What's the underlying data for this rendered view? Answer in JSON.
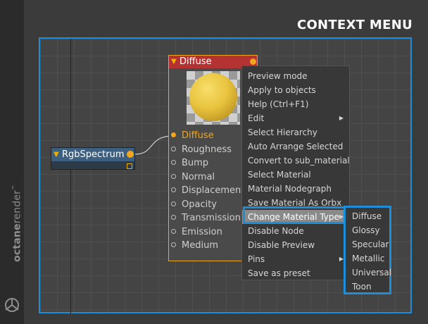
{
  "page": {
    "title": "CONTEXT MENU",
    "brand": {
      "text_bold": "octane",
      "text_regular": "render",
      "trademark": "™"
    }
  },
  "colors": {
    "accent_blue": "#1e8ed8",
    "pin_orange": "#f2a619",
    "node_header_red": "#b53232",
    "node_header_blue": "#3d5f80"
  },
  "nodes": {
    "rgb_spectrum": {
      "title": "RgbSpectrum",
      "icons": [
        "collapse-triangle-icon",
        "output-pin-icon",
        "resize-handle-icon"
      ]
    },
    "diffuse": {
      "title": "Diffuse",
      "preview": "yellow-sphere-preview",
      "pins": [
        {
          "label": "Diffuse",
          "connected": true
        },
        {
          "label": "Roughness",
          "connected": false
        },
        {
          "label": "Bump",
          "connected": false
        },
        {
          "label": "Normal",
          "connected": false
        },
        {
          "label": "Displacement",
          "connected": false
        },
        {
          "label": "Opacity",
          "connected": false
        },
        {
          "label": "Transmission",
          "connected": false
        },
        {
          "label": "Emission",
          "connected": false
        },
        {
          "label": "Medium",
          "connected": false
        }
      ]
    }
  },
  "context_menu": {
    "items": [
      {
        "label": "Preview mode",
        "submenu": false
      },
      {
        "label": "Apply to objects",
        "submenu": false
      },
      {
        "label": "Help (Ctrl+F1)",
        "submenu": false
      },
      {
        "label": "Edit",
        "submenu": true
      },
      {
        "label": "Select Hierarchy",
        "submenu": false
      },
      {
        "label": "Auto Arrange Selected",
        "submenu": false
      },
      {
        "label": "Convert to sub_material",
        "submenu": false
      },
      {
        "label": "Select Material",
        "submenu": false
      },
      {
        "label": "Material Nodegraph",
        "submenu": false
      },
      {
        "label": "Save Material As Orbx",
        "submenu": false
      },
      {
        "label": "Change Material Type",
        "submenu": true,
        "highlighted": true
      },
      {
        "label": "Disable Node",
        "submenu": false
      },
      {
        "label": "Disable Preview",
        "submenu": false
      },
      {
        "label": "Pins",
        "submenu": true
      },
      {
        "label": "Save as preset",
        "submenu": false
      }
    ],
    "submenu_arrow": "▶",
    "change_material_type_submenu": [
      "Diffuse",
      "Glossy",
      "Specular",
      "Metallic",
      "Universal",
      "Toon"
    ]
  }
}
